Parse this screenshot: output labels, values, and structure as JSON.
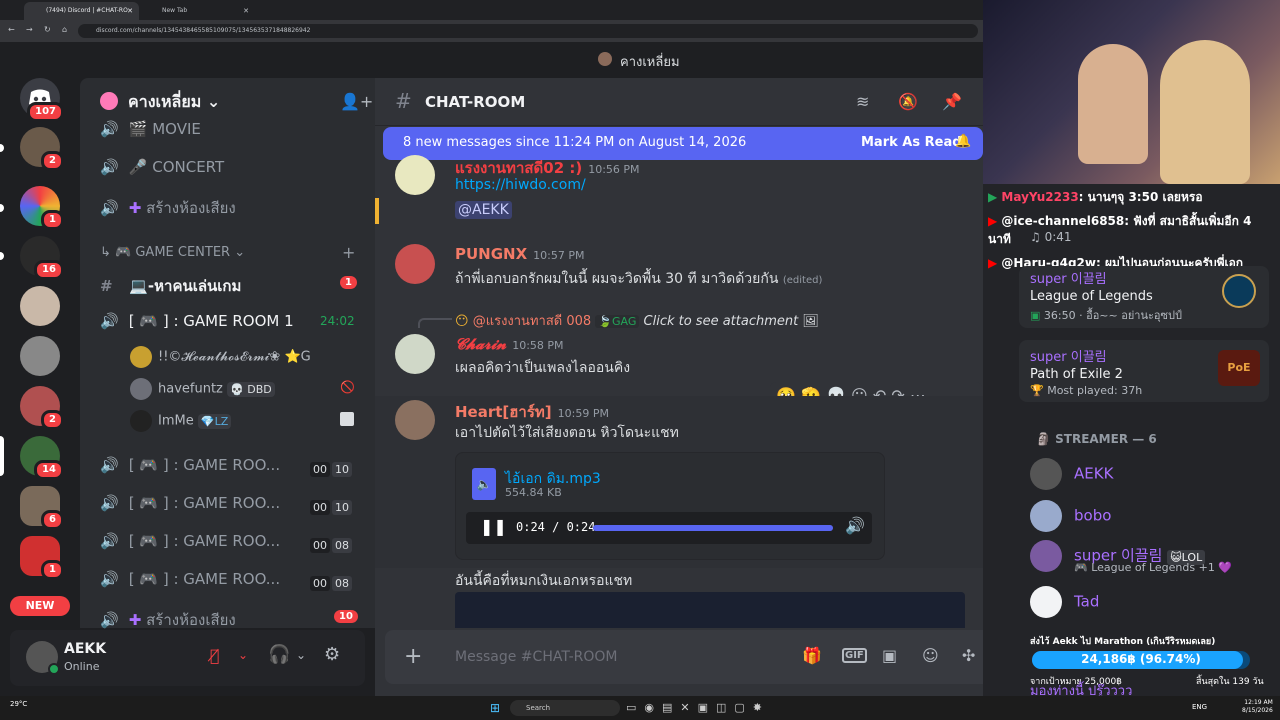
{
  "browser": {
    "tabs": [
      {
        "label": "(7494) Discord | #CHAT-RO"
      },
      {
        "label": "New Tab"
      }
    ],
    "url": "discord.com/channels/1345438465585109075/1345635371848826942"
  },
  "window": {
    "title": "คางเหลี่ยม"
  },
  "servers": {
    "badges": [
      "107",
      "2",
      "1",
      "16",
      "2",
      "14",
      "6",
      "1"
    ],
    "new_label": "NEW"
  },
  "guild": {
    "name": "คางเหลี่ยม"
  },
  "channels": {
    "movie": "MOVIE",
    "concert": "CONCERT",
    "create_voice_1": "สร้างห้องเสียง",
    "category_game": "GAME CENTER",
    "find_players": "-หาคนเล่นเกม",
    "find_players_badge": "1",
    "game_room_1": "[ 🎮 ] : GAME ROOM 1",
    "game_room_1_time": "24:02",
    "voice_users": [
      {
        "name": "!!©𝓗𝓮𝓪𝓷𝓽𝓱𝓸𝓼𝓔𝓻𝓶𝓲❀",
        "tag": "G"
      },
      {
        "name": "havefuntz",
        "tag": "DBD"
      },
      {
        "name": "ImMe",
        "tag": "LZ"
      }
    ],
    "game_rooms": [
      {
        "label": "[ 🎮 ] : GAME ROO...",
        "a": "00",
        "b": "10"
      },
      {
        "label": "[ 🎮 ] : GAME ROO...",
        "a": "00",
        "b": "10"
      },
      {
        "label": "[ 🎮 ] : GAME ROO...",
        "a": "00",
        "b": "08"
      },
      {
        "label": "[ 🎮 ] : GAME ROO...",
        "a": "00",
        "b": "08"
      }
    ],
    "create_voice_2": "สร้างห้องเสียง",
    "create_voice_2_badge": "10"
  },
  "user": {
    "name": "AEKK",
    "status": "Online"
  },
  "chat": {
    "channel": "CHAT-ROOM",
    "new_messages": "8 new messages since 11:24 PM on August 14, 2026",
    "mark_read": "Mark As Read",
    "messages": [
      {
        "author": "แรงงานทาสดี02 :)",
        "time": "10:56 PM",
        "link": "https://hiwdo.com/",
        "mention": "@AEKK"
      },
      {
        "author": "PUNGNX",
        "time": "10:57 PM",
        "text": "ถ้าพี่เอกบอกรักผมในนี้ ผมจะวิดพื้น 30 ที มาวิดด้วยกัน",
        "edited": "(edited)"
      },
      {
        "reply_author": "@แรงงานทาสดี 008",
        "reply_tag": "GAG",
        "reply_text": "Click to see attachment",
        "author": "𝓒𝓱𝓪𝓻𝓲𝓷",
        "time": "10:58 PM",
        "text": "เผลอคิดว่าเป็นเพลงไลออนคิง"
      },
      {
        "author": "Heart[ฮาร์ท]",
        "time": "10:59 PM",
        "text": "เอาไปตัดไว้ใส่เสียงตอน หิวโดนะแชท"
      },
      {
        "text": "อันนี้คือที่หมกเงินเอกหรอแชท"
      }
    ],
    "audio": {
      "filename": "ไอ้เอก ดิม.mp3",
      "size": "554.84 KB",
      "time": "0:24 / 0:24",
      "progress": 1.0
    },
    "input_placeholder": "Message #CHAT-ROOM"
  },
  "stream": {
    "chat_lines": [
      {
        "user": "MayYu2233",
        "text": ": นานๆจุ 3:50 เลยหรอ",
        "color": "#ff4466"
      },
      {
        "user": "@ice-channel6858",
        "text": ": ฟังที่ สมาธิสั้นเพิ่มอีก 4 นาที",
        "color": "#ffffff"
      },
      {
        "user": "@Haru-g4g2w",
        "text": ": ผมไปนอนก่อนนะครับพี่เอก",
        "color": "#ffffff"
      }
    ],
    "activities": [
      {
        "user": "super 이끌림",
        "game": "League of Legends",
        "detail": "36:50 · อื้อ~~ อย่านะอุซปป์"
      },
      {
        "user": "super 이끌림",
        "game": "Path of Exile 2",
        "detail": "Most played: 37h"
      }
    ],
    "members_header": "STREAMER — 6",
    "members": [
      {
        "name": "AEKK",
        "color": "#a970ff"
      },
      {
        "name": "bobo",
        "color": "#a970ff"
      },
      {
        "name": "super 이끌림",
        "color": "#a970ff",
        "tag": "LOL",
        "sub": "League of Legends +1"
      },
      {
        "name": "Tad",
        "color": "#a970ff"
      },
      {
        "name": "มองท่างนี้ ปรู๊วววว",
        "color": "#a970ff"
      }
    ],
    "goal_title": "ส่งไว้ Aekk ไป Marathon (เกินวีริรหมดเลย)",
    "goal_value": "24,186฿ (96.74%)",
    "goal_progress": 0.9674,
    "goal_target": "จากเป้าหมาย 25,000฿",
    "goal_end": "สิ้นสุดใน 139 วัน",
    "old_time": "0:41"
  },
  "taskbar": {
    "weather": "29°C",
    "search": "Search",
    "lang": "ENG",
    "time": "12:19 AM",
    "date": "8/15/2026"
  }
}
